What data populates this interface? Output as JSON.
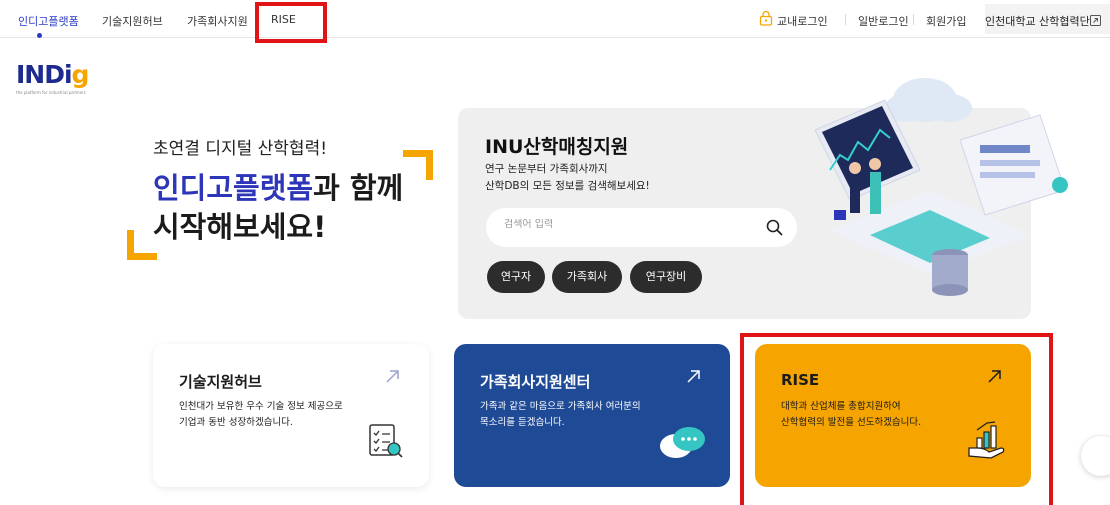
{
  "nav": {
    "tabs": [
      {
        "label": "인디고플랫폼"
      },
      {
        "label": "기술지원허브"
      },
      {
        "label": "가족회사지원"
      },
      {
        "label": "RISE"
      }
    ],
    "campus_login": "교내로그인",
    "general_login": "일반로그인",
    "signup": "회원가입",
    "corp_link": "인천대학교 산학협력단"
  },
  "logo": {
    "text_main": "INDi",
    "text_accent": "g",
    "sub": "the platform for industrial partners"
  },
  "hero": {
    "subtitle": "초연결 디지털 산학협력!",
    "title_accent": "인디고플랫폼",
    "title_rest": "과 함께",
    "title_line2": "시작해보세요!"
  },
  "search_card": {
    "title": "INU산학매칭지원",
    "desc_line1": "연구 논문부터 가족회사까지",
    "desc_line2": "산학DB의 모든 정보를 검색해보세요!",
    "placeholder": "검색어 입력",
    "chips": [
      "연구자",
      "가족회사",
      "연구장비"
    ]
  },
  "cards": [
    {
      "title": "기술지원허브",
      "desc_line1": "인천대가 보유한 우수 기술 정보 제공으로",
      "desc_line2": "기업과 동반 성장하겠습니다."
    },
    {
      "title": "가족회사지원센터",
      "desc_line1": "가족과 같은 마음으로 가족회사 여러분의",
      "desc_line2": "목소리를 듣겠습니다."
    },
    {
      "title": "RISE",
      "desc_line1": "대학과 산업체를 총합지원하여",
      "desc_line2": "산학협력의 발전을 선도하겠습니다."
    }
  ],
  "colors": {
    "primary": "#2d36b8",
    "accent_orange": "#f5a400",
    "navy_card": "#1f4a96",
    "highlight_red": "#e01414"
  },
  "icons": [
    "lock-icon",
    "external-link-icon",
    "search-icon",
    "arrow-up-right-icon",
    "checklist-icon",
    "chat-bubble-icon",
    "growth-hand-icon"
  ]
}
